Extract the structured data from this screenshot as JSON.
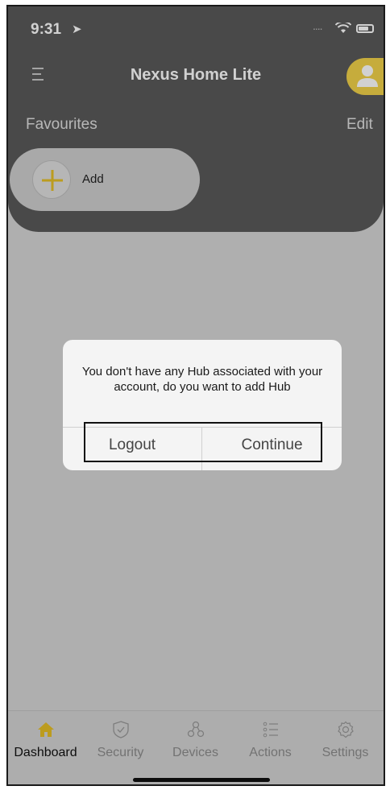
{
  "status_bar": {
    "time": "9:31",
    "location_arrow": "➤",
    "signal_dots": "...."
  },
  "header": {
    "title": "Nexus Home Lite",
    "menu_icon": "hamburger-menu-icon",
    "avatar_icon": "user-avatar-icon"
  },
  "favourites": {
    "label": "Favourites",
    "edit_label": "Edit",
    "add_label": "Add",
    "add_icon": "plus-icon"
  },
  "dialog": {
    "message": "You don't have any Hub associated with your account, do you want to add Hub",
    "logout_label": "Logout",
    "continue_label": "Continue"
  },
  "tabs": [
    {
      "label": "Dashboard",
      "icon": "home-icon",
      "active": true
    },
    {
      "label": "Security",
      "icon": "shield-icon",
      "active": false
    },
    {
      "label": "Devices",
      "icon": "devices-icon",
      "active": false
    },
    {
      "label": "Actions",
      "icon": "list-icon",
      "active": false
    },
    {
      "label": "Settings",
      "icon": "gear-icon",
      "active": false
    }
  ],
  "colors": {
    "accent": "#f2d24a",
    "header_bg": "#5a5a5a",
    "page_bg": "#d6d6d6"
  }
}
